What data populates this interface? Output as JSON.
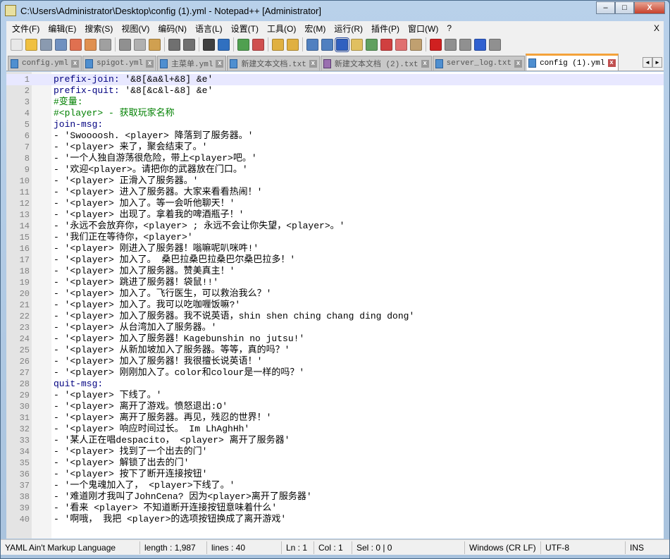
{
  "window": {
    "title": "C:\\Users\\Administrator\\Desktop\\config (1).yml - Notepad++ [Administrator]",
    "minimize": "–",
    "maximize": "□",
    "close": "X"
  },
  "menu": {
    "items": [
      "文件(F)",
      "编辑(E)",
      "搜索(S)",
      "视图(V)",
      "编码(N)",
      "语言(L)",
      "设置(T)",
      "工具(O)",
      "宏(M)",
      "运行(R)",
      "插件(P)",
      "窗口(W)",
      "?"
    ],
    "close": "X"
  },
  "toolbar": {
    "icons": [
      {
        "name": "new-file-icon",
        "color": "#e8e8e8"
      },
      {
        "name": "open-file-icon",
        "color": "#f0c040"
      },
      {
        "name": "save-icon",
        "color": "#8a9ab0"
      },
      {
        "name": "save-all-icon",
        "color": "#7090c0"
      },
      {
        "name": "close-icon",
        "color": "#e07050"
      },
      {
        "name": "close-all-icon",
        "color": "#e09050"
      },
      {
        "name": "print-icon",
        "color": "#a0a0a0"
      },
      "sep",
      {
        "name": "cut-icon",
        "color": "#909090"
      },
      {
        "name": "copy-icon",
        "color": "#b0b0b0"
      },
      {
        "name": "paste-icon",
        "color": "#d0a050"
      },
      "sep",
      {
        "name": "undo-icon",
        "color": "#707070"
      },
      {
        "name": "redo-icon",
        "color": "#707070"
      },
      "sep",
      {
        "name": "find-icon",
        "color": "#404040"
      },
      {
        "name": "replace-icon",
        "color": "#3070c0"
      },
      "sep",
      {
        "name": "zoom-in-icon",
        "color": "#50a050"
      },
      {
        "name": "zoom-out-icon",
        "color": "#d05050"
      },
      "sep",
      {
        "name": "sync-vertical-icon",
        "color": "#e0b040"
      },
      {
        "name": "sync-horizontal-icon",
        "color": "#e0b040"
      },
      "sep",
      {
        "name": "word-wrap-icon",
        "color": "#5080c0"
      },
      {
        "name": "show-all-chars-icon",
        "color": "#5080c0"
      },
      {
        "name": "indent-guide-icon",
        "color": "#3060c0"
      },
      {
        "name": "udl-icon",
        "color": "#e0c060"
      },
      {
        "name": "doc-map-icon",
        "color": "#60a060"
      },
      {
        "name": "function-list-icon",
        "color": "#d04040"
      },
      {
        "name": "folder-workspace-icon",
        "color": "#e07070"
      },
      {
        "name": "monitoring-icon",
        "color": "#c0a070"
      },
      "sep",
      {
        "name": "record-macro-icon",
        "color": "#d02020"
      },
      {
        "name": "stop-macro-icon",
        "color": "#909090"
      },
      {
        "name": "play-macro-icon",
        "color": "#909090"
      },
      {
        "name": "run-macro-multiple-icon",
        "color": "#3060d0"
      },
      {
        "name": "save-macro-icon",
        "color": "#909090"
      }
    ]
  },
  "tabs": [
    {
      "label": "config.yml",
      "color": "blue",
      "active": false
    },
    {
      "label": "spigot.yml",
      "color": "blue",
      "active": false
    },
    {
      "label": "主菜单.yml",
      "color": "blue",
      "active": false
    },
    {
      "label": "新建文本文档.txt",
      "color": "blue",
      "active": false
    },
    {
      "label": "新建文本文档 (2).txt",
      "color": "purple",
      "active": false
    },
    {
      "label": "server_log.txt",
      "color": "blue",
      "active": false
    },
    {
      "label": "config (1).yml",
      "color": "blue",
      "active": true
    }
  ],
  "tab_close": "x",
  "tab_nav": [
    "◄",
    "►"
  ],
  "lines": [
    {
      "key": "prefix-join:",
      "text": " '&8[&a&l+&8] &e'"
    },
    {
      "key": "prefix-quit:",
      "text": " '&8[&c&l-&8] &e'"
    },
    {
      "comment": "#变量:"
    },
    {
      "comment": "#<player> - 获取玩家名称"
    },
    {
      "key": "join-msg:",
      "text": ""
    },
    {
      "text": "- 'Swoooosh. <player> 降落到了服务器。'"
    },
    {
      "text": "- '<player> 来了，聚会结束了。'"
    },
    {
      "text": "- '一个人独自游荡很危险，带上<player>吧。'"
    },
    {
      "text": "- '欢迎<player>。请把你的武器放在门口。'"
    },
    {
      "text": "- '<player> 正滑入了服务器。'"
    },
    {
      "text": "- '<player> 进入了服务器。大家来看看热闹！'"
    },
    {
      "text": "- '<player> 加入了。等一会听他聊天！'"
    },
    {
      "text": "- '<player> 出现了。拿着我的啤酒瓶子！'"
    },
    {
      "text": "- '永远不会放弃你，<player> ; 永远不会让你失望，<player>。'"
    },
    {
      "text": "- '我们正在等待你，<player>'"
    },
    {
      "text": "- '<player> 刚进入了服务器！嗡嘛呢叭咪吽!'"
    },
    {
      "text": "- '<player> 加入了。 桑巴拉桑巴拉桑巴尔桑巴拉多！'"
    },
    {
      "text": "- '<player> 加入了服务器。赞美真主！'"
    },
    {
      "text": "- '<player> 跳进了服务器！袋鼠!!'"
    },
    {
      "text": "- '<player> 加入了。飞行医生，可以救治我么？'"
    },
    {
      "text": "- '<player> 加入了。我可以吃咖喱饭嘛?'"
    },
    {
      "text": "- '<player> 加入了服务器。我不说英语，shin shen ching chang ding dong'"
    },
    {
      "text": "- '<player> 从台湾加入了服务器。'"
    },
    {
      "text": "- '<player> 加入了服务器！Kagebunshin no jutsu!'"
    },
    {
      "text": "- '<player> 从新加坡加入了服务器。等等，真的吗？'"
    },
    {
      "text": "- '<player> 加入了服务器！我很擅长说英语！'"
    },
    {
      "text": "- '<player> 刚刚加入了。color和colour是一样的吗？'"
    },
    {
      "key": "quit-msg:",
      "text": ""
    },
    {
      "text": "- '<player> 下线了。'"
    },
    {
      "text": "- '<player> 离开了游戏。愤怒退出:O'"
    },
    {
      "text": "- '<player> 离开了服务器。再见，残忍的世界！'"
    },
    {
      "text": "- '<player> 响应时间过长。 Im LhAghHh'"
    },
    {
      "text": "- '某人正在唱despacito， <player> 离开了服务器'"
    },
    {
      "text": "- '<player> 找到了一个出去的门'"
    },
    {
      "text": "- '<player> 解锁了出去的门'"
    },
    {
      "text": "- '<player> 按下了断开连接按钮'"
    },
    {
      "text": "- '一个鬼魂加入了， <player>下线了。'"
    },
    {
      "text": "- '难道刚才我叫了JohnCena? 因为<player>离开了服务器'"
    },
    {
      "text": "- '看来 <player> 不知道断开连接按钮意味着什么'"
    },
    {
      "text": "- '啊哦， 我把 <player>的选项按钮换成了离开游戏'"
    }
  ],
  "current_line": 1,
  "status": {
    "language": "YAML Ain't Markup Language",
    "length": "length : 1,987",
    "lines": "lines : 40",
    "ln": "Ln : 1",
    "col": "Col : 1",
    "sel": "Sel : 0 | 0",
    "eol": "Windows (CR LF)",
    "encoding": "UTF-8",
    "mode": "INS"
  }
}
